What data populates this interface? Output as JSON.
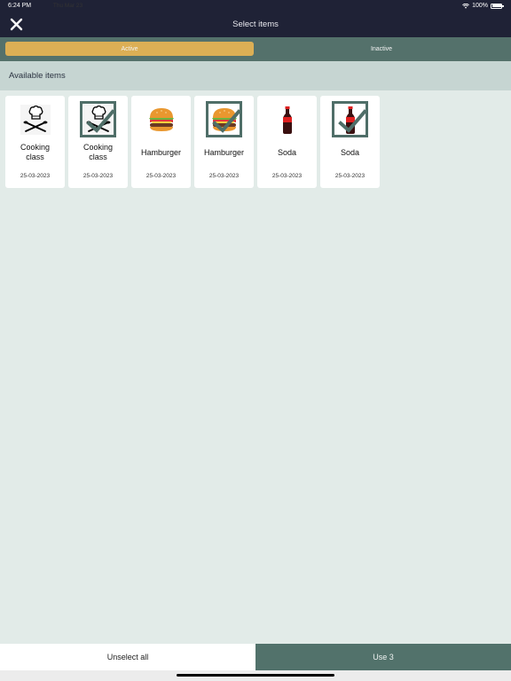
{
  "status_bar": {
    "time": "6:24 PM",
    "date": "Thu Mar 23",
    "battery": "100%"
  },
  "header": {
    "title": "Select items",
    "close_icon": "close-icon"
  },
  "tabs": [
    {
      "label": "Active",
      "selected": true
    },
    {
      "label": "Inactive",
      "selected": false
    }
  ],
  "section": {
    "title": "Available items"
  },
  "items": [
    {
      "name": "Cooking class",
      "date": "25-03-2023",
      "icon": "chef-icon",
      "selected": false
    },
    {
      "name": "Cooking class",
      "date": "25-03-2023",
      "icon": "chef-icon",
      "selected": true
    },
    {
      "name": "Hamburger",
      "date": "25-03-2023",
      "icon": "hamburger-icon",
      "selected": false
    },
    {
      "name": "Hamburger",
      "date": "25-03-2023",
      "icon": "hamburger-icon",
      "selected": true
    },
    {
      "name": "Soda",
      "date": "25-03-2023",
      "icon": "soda-bottle-icon",
      "selected": false
    },
    {
      "name": "Soda",
      "date": "25-03-2023",
      "icon": "soda-bottle-icon",
      "selected": true
    }
  ],
  "footer": {
    "unselect_label": "Unselect all",
    "use_label": "Use 3"
  },
  "colors": {
    "header_bg": "#1f2236",
    "tab_bar": "#54716b",
    "active_tab": "#dcaf55",
    "section_bg": "#c6d5d2",
    "accent": "#52726b"
  }
}
